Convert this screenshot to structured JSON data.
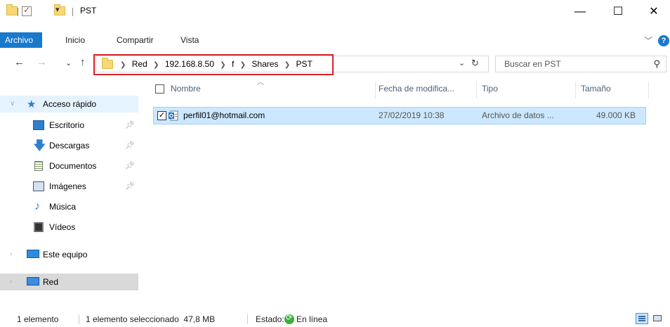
{
  "window": {
    "title": "PST",
    "minimize_glyph": "—",
    "maximize_glyph": "☐",
    "close_glyph": "✕"
  },
  "ribbon": {
    "tabs": [
      "Archivo",
      "Inicio",
      "Compartir",
      "Vista"
    ],
    "help_glyph": "?"
  },
  "address_bar": {
    "crumbs": [
      "Red",
      "192.168.8.50",
      "f",
      "Shares",
      "PST"
    ],
    "highlight_color": "#d8232a"
  },
  "search": {
    "placeholder": "Buscar en PST"
  },
  "sidebar": {
    "quick_access": "Acceso rápido",
    "items": [
      "Escritorio",
      "Descargas",
      "Documentos",
      "Imágenes",
      "Música",
      "Vídeos"
    ],
    "this_pc": "Este equipo",
    "network": "Red"
  },
  "columns": {
    "name": "Nombre",
    "date": "Fecha de modifica...",
    "type": "Tipo",
    "size": "Tamaño"
  },
  "files": [
    {
      "name": "perfil01@hotmail.com",
      "date": "27/02/2019 10:38",
      "type": "Archivo de datos ...",
      "size": "49.000 KB",
      "selected": true
    }
  ],
  "status": {
    "count": "1 elemento",
    "selection": "1 elemento seleccionado  47,8 MB",
    "state_label": "Estado:",
    "state_value": "En línea"
  },
  "colors": {
    "accent": "#1979ca",
    "selection_bg": "#cce8ff"
  }
}
